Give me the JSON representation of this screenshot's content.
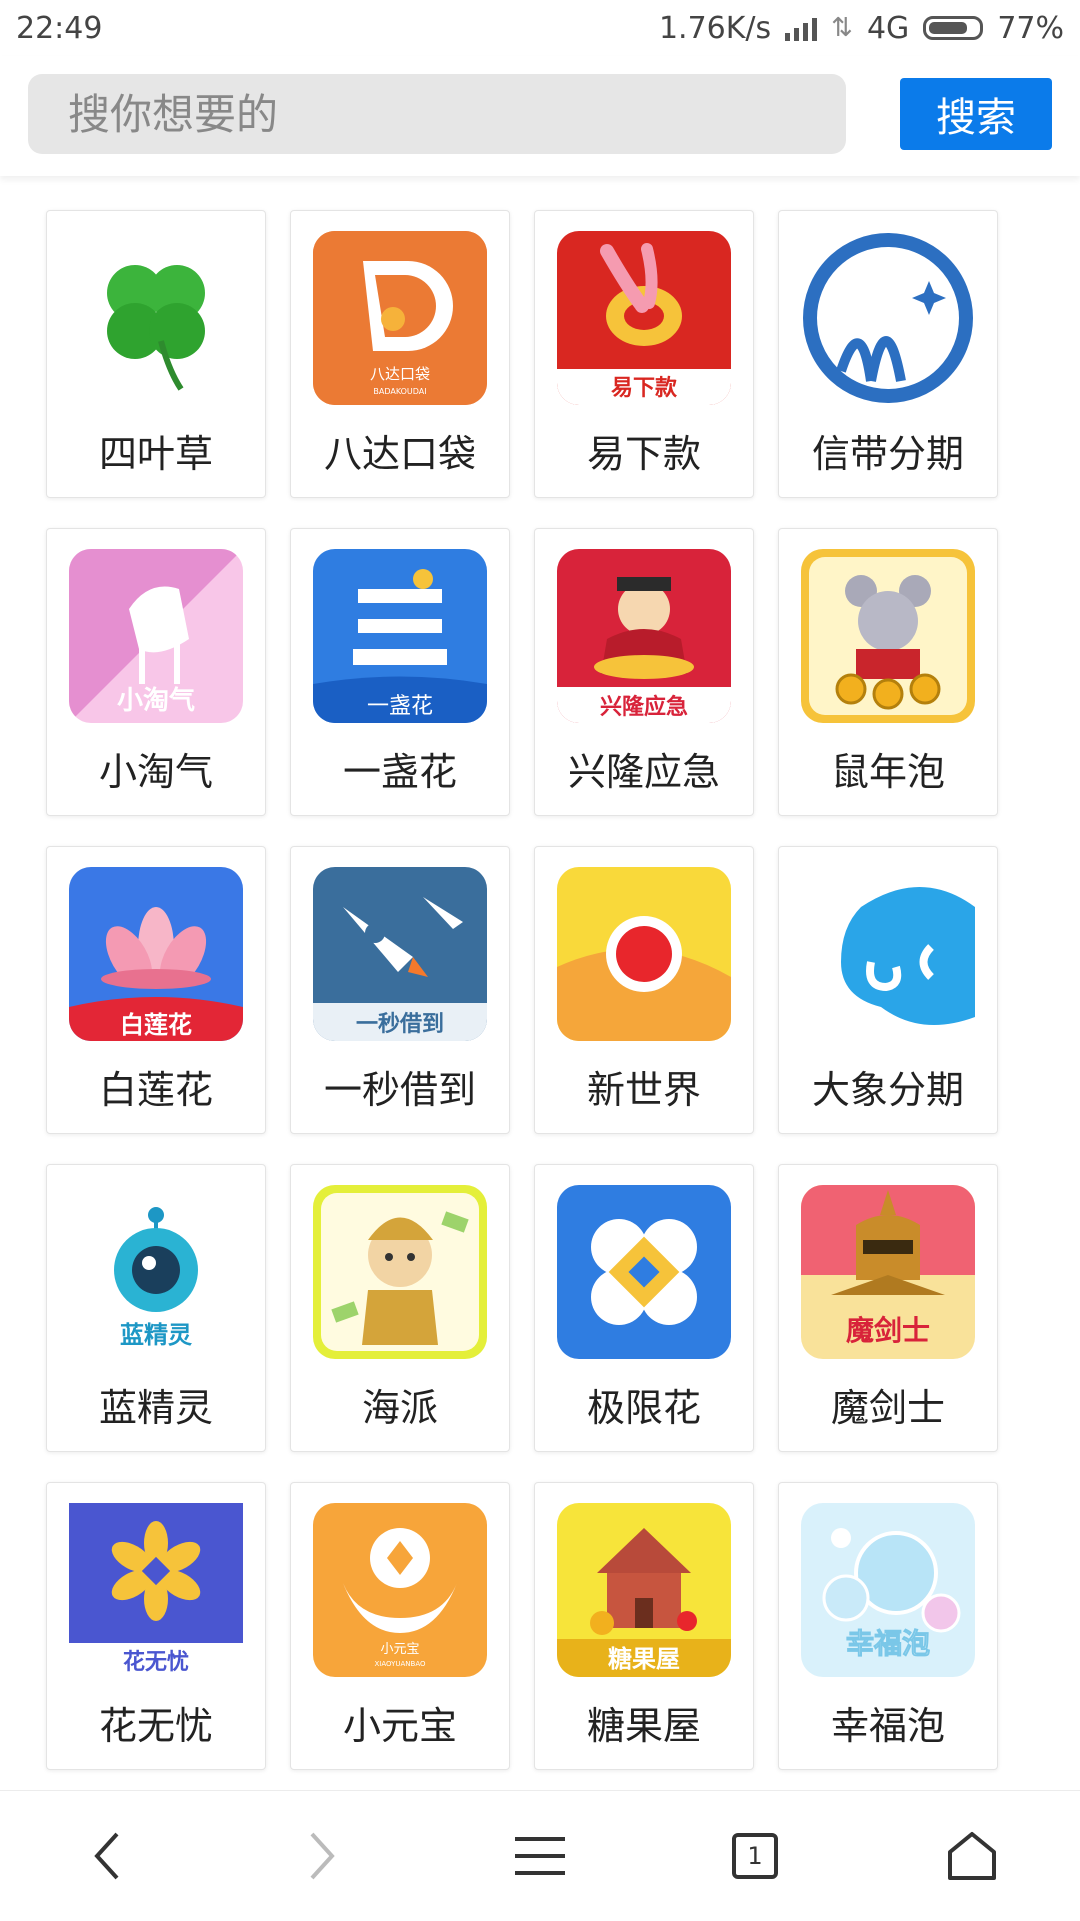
{
  "status_bar": {
    "time": "22:49",
    "net_speed": "1.76K/s",
    "network": "4G",
    "battery": "77%"
  },
  "search": {
    "placeholder": "搜你想要的",
    "button_label": "搜索"
  },
  "apps": [
    {
      "name": "四叶草",
      "icon": "clover-icon"
    },
    {
      "name": "八达口袋",
      "icon": "badakoudai-icon",
      "icon_text": "八达口袋",
      "icon_subtext": "BADAKOUDAI"
    },
    {
      "name": "易下款",
      "icon": "yixiakuan-icon",
      "icon_text": "易下款"
    },
    {
      "name": "信带分期",
      "icon": "xindai-icon"
    },
    {
      "name": "小淘气",
      "icon": "xiaotaoqi-icon",
      "icon_text": "小淘气"
    },
    {
      "name": "一盏花",
      "icon": "yizhanhua-icon",
      "icon_text": "一盏花"
    },
    {
      "name": "兴隆应急",
      "icon": "xinglong-icon",
      "icon_text": "兴隆应急"
    },
    {
      "name": "鼠年泡",
      "icon": "shunianpao-icon"
    },
    {
      "name": "白莲花",
      "icon": "bailianhua-icon",
      "icon_text": "白莲花"
    },
    {
      "name": "一秒借到",
      "icon": "yimiaojiedao-icon",
      "icon_text": "一秒借到"
    },
    {
      "name": "新世界",
      "icon": "xinshijie-icon"
    },
    {
      "name": "大象分期",
      "icon": "daxiang-icon"
    },
    {
      "name": "蓝精灵",
      "icon": "lanjingling-icon",
      "icon_text": "蓝精灵"
    },
    {
      "name": "海派",
      "icon": "haipai-icon"
    },
    {
      "name": "极限花",
      "icon": "jixianhua-icon"
    },
    {
      "name": "魔剑士",
      "icon": "mojianshi-icon",
      "icon_text": "魔剑士"
    },
    {
      "name": "花无忧",
      "icon": "huawuyou-icon",
      "icon_text": "花无忧"
    },
    {
      "name": "小元宝",
      "icon": "xiaoyuanbao-icon",
      "icon_text": "小元宝",
      "icon_subtext": "XIAOYUANBAO"
    },
    {
      "name": "糖果屋",
      "icon": "tangguowu-icon",
      "icon_text": "糖果屋"
    },
    {
      "name": "幸福泡",
      "icon": "xingfupao-icon",
      "icon_text": "幸福泡"
    }
  ],
  "bottom_nav": {
    "tab_count": "1"
  },
  "colors": {
    "accent": "#0b7bea",
    "search_bg": "#e6e6e6"
  }
}
